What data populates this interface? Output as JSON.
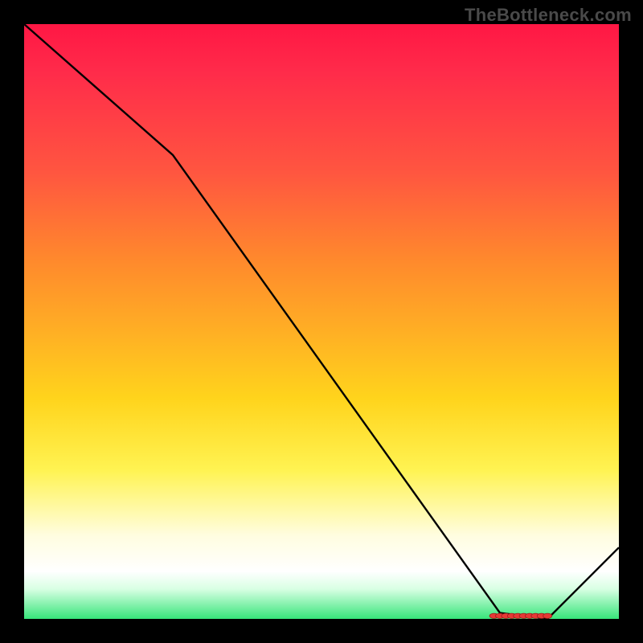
{
  "watermark": "TheBottleneck.com",
  "colors": {
    "gradient_top": "#ff1744",
    "gradient_mid": "#ffd41c",
    "gradient_bottom": "#37e57a",
    "line": "#000000",
    "markers": "#e53935",
    "frame_bg": "#000000"
  },
  "chart_data": {
    "type": "line",
    "title": "",
    "xlabel": "",
    "ylabel": "",
    "xlim": [
      0,
      100
    ],
    "ylim": [
      0,
      100
    ],
    "grid": false,
    "legend": false,
    "x": [
      0,
      25,
      80,
      88,
      100
    ],
    "values": [
      100,
      78,
      1,
      0,
      12
    ],
    "markers_x": [
      79,
      80,
      81,
      82,
      83,
      84,
      85,
      86,
      87,
      88
    ],
    "markers_y": [
      0.5,
      0.5,
      0.5,
      0.5,
      0.5,
      0.5,
      0.5,
      0.5,
      0.5,
      0.5
    ]
  }
}
